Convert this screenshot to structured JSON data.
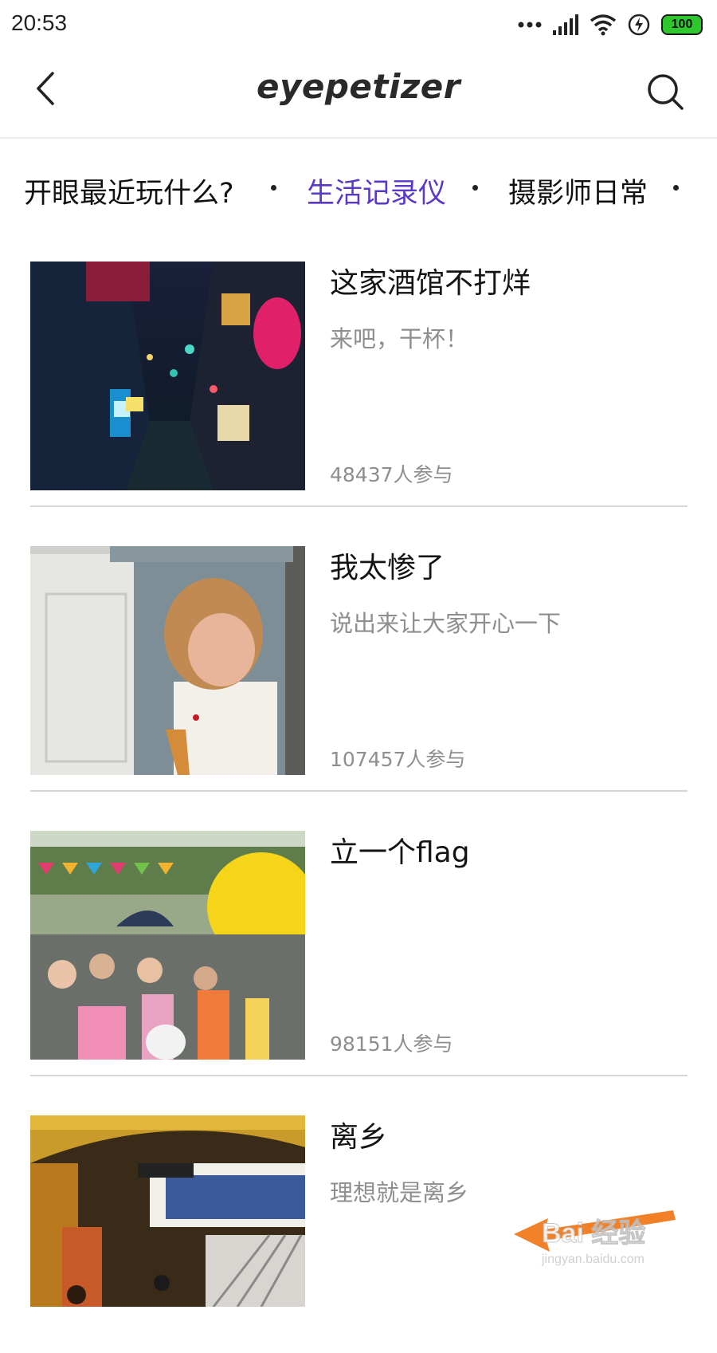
{
  "status_bar": {
    "time": "20:53",
    "battery": "100",
    "icons": [
      "more-dots-icon",
      "signal-icon",
      "wifi-icon",
      "charging-icon",
      "battery-icon"
    ]
  },
  "header": {
    "brand": "eyepetizer",
    "back_icon": "chevron-left-icon",
    "search_icon": "search-icon"
  },
  "tabs": [
    {
      "label": "开眼最近玩什么?",
      "active": false
    },
    {
      "label": "生活记录仪",
      "active": true
    },
    {
      "label": "摄影师日常",
      "active": false
    }
  ],
  "colors": {
    "accent": "#5a39c7",
    "secondary_text": "#8e8e8e",
    "divider": "#d6d6d6"
  },
  "items": [
    {
      "title": "这家酒馆不打烊",
      "subtitle": "来吧，干杯！",
      "count": "48437人参与",
      "thumb_icon": "night-alley-photo"
    },
    {
      "title": "我太惨了",
      "subtitle": "说出来让大家开心一下",
      "count": "107457人参与",
      "thumb_icon": "crying-child-photo"
    },
    {
      "title": "立一个flag",
      "subtitle": "",
      "count": "98151人参与",
      "thumb_icon": "songkran-festival-photo"
    },
    {
      "title": "离乡",
      "subtitle": "理想就是离乡",
      "count": "",
      "thumb_icon": "train-station-photo"
    }
  ],
  "watermark": {
    "brand": "Bai 经验",
    "url": "jingyan.baidu.com"
  }
}
